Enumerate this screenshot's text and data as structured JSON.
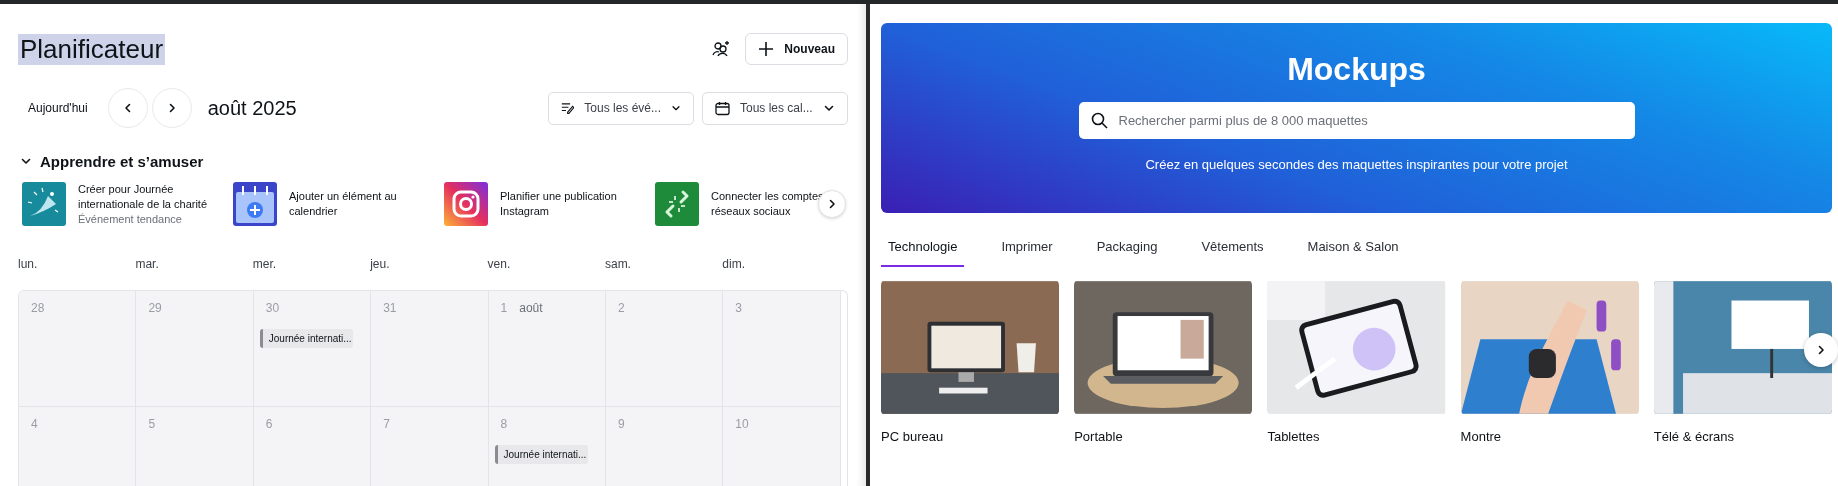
{
  "planner": {
    "title": "Planificateur",
    "title_highlighted": true,
    "new_button": "Nouveau",
    "today_button": "Aujourd'hui",
    "month": "août 2025",
    "filters": [
      {
        "kind": "events",
        "label": "Tous les évé..."
      },
      {
        "kind": "calendar",
        "label": "Tous les cal..."
      }
    ],
    "section": {
      "title": "Apprendre et s’amuser",
      "expanded": true,
      "items": [
        {
          "kind": "charity",
          "title": "Créer pour Journée internationale de la charité",
          "subtitle": "Événement tendance"
        },
        {
          "kind": "calendar",
          "title": "Ajouter un élément au calendrier"
        },
        {
          "kind": "instagram",
          "title": "Planifier une publication Instagram"
        },
        {
          "kind": "link",
          "title": "Connecter les comptes réseaux sociaux"
        }
      ]
    },
    "weekdays": [
      "lun.",
      "mar.",
      "mer.",
      "jeu.",
      "ven.",
      "sam.",
      "dim."
    ],
    "weeks": [
      [
        {
          "day": "28"
        },
        {
          "day": "29"
        },
        {
          "day": "30",
          "events": [
            "Journée internati..."
          ]
        },
        {
          "day": "31"
        },
        {
          "day": "1",
          "month_label": "août"
        },
        {
          "day": "2"
        },
        {
          "day": "3"
        }
      ],
      [
        {
          "day": "4"
        },
        {
          "day": "5"
        },
        {
          "day": "6"
        },
        {
          "day": "7"
        },
        {
          "day": "8",
          "events": [
            "Journée internati..."
          ]
        },
        {
          "day": "9"
        },
        {
          "day": "10"
        }
      ]
    ]
  },
  "mockups": {
    "title": "Mockups",
    "search": {
      "placeholder": "Rechercher parmi plus de 8 000 maquettes"
    },
    "subtitle": "Créez en quelques secondes des maquettes inspirantes pour votre projet",
    "tabs": [
      {
        "label": "Technologie",
        "selected": true
      },
      {
        "label": "Imprimer",
        "selected": false
      },
      {
        "label": "Packaging",
        "selected": false
      },
      {
        "label": "Vêtements",
        "selected": false
      },
      {
        "label": "Maison & Salon",
        "selected": false
      }
    ],
    "cards": [
      {
        "label": "PC bureau"
      },
      {
        "label": "Portable"
      },
      {
        "label": "Tablettes"
      },
      {
        "label": "Montre"
      },
      {
        "label": "Télé & écrans"
      }
    ]
  }
}
